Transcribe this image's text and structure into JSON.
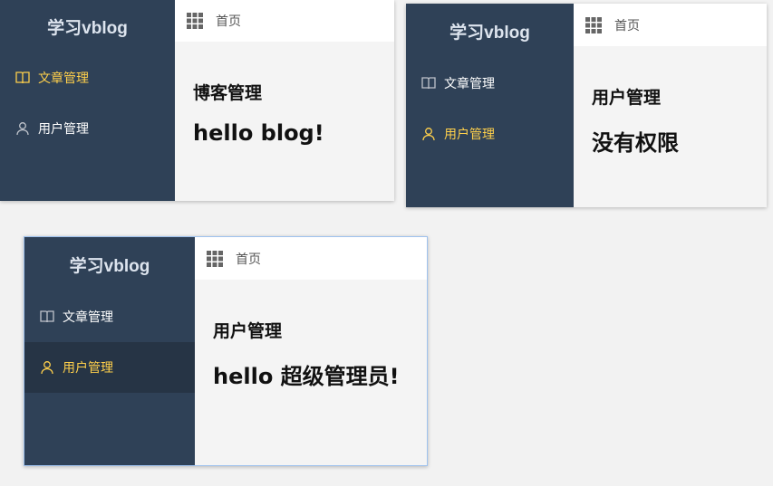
{
  "panels": [
    {
      "brand": "学习vblog",
      "menu": [
        {
          "label": "文章管理",
          "icon": "book-icon",
          "active": true
        },
        {
          "label": "用户管理",
          "icon": "user-icon",
          "active": false
        }
      ],
      "breadcrumb": "首页",
      "heading": "博客管理",
      "message": "hello blog!"
    },
    {
      "brand": "学习vblog",
      "menu": [
        {
          "label": "文章管理",
          "icon": "book-icon",
          "active": false
        },
        {
          "label": "用户管理",
          "icon": "user-icon",
          "active": true
        }
      ],
      "breadcrumb": "首页",
      "heading": "用户管理",
      "message": "没有权限"
    },
    {
      "brand": "学习vblog",
      "menu": [
        {
          "label": "文章管理",
          "icon": "book-icon",
          "active": false
        },
        {
          "label": "用户管理",
          "icon": "user-icon",
          "active": true
        }
      ],
      "breadcrumb": "首页",
      "heading": "用户管理",
      "message": "hello 超级管理员!"
    }
  ],
  "colors": {
    "sidebar_bg": "#2f4157",
    "active_text": "#ffd04b",
    "content_bg": "#f4f4f4"
  }
}
